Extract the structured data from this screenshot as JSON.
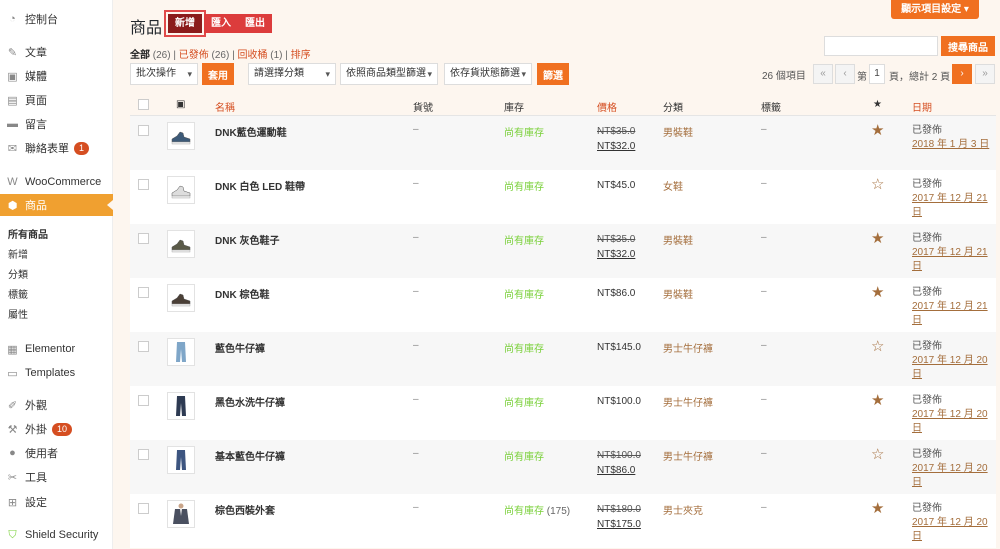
{
  "sidebar": {
    "items": [
      {
        "label": "控制台",
        "icon": "dashboard-icon",
        "glyph": "◔"
      },
      {
        "label": "文章",
        "icon": "pushpin-icon",
        "glyph": "✎"
      },
      {
        "label": "媒體",
        "icon": "media-icon",
        "glyph": "▣"
      },
      {
        "label": "頁面",
        "icon": "page-icon",
        "glyph": "▤"
      },
      {
        "label": "留言",
        "icon": "comment-icon",
        "glyph": "▬"
      },
      {
        "label": "聯絡表單",
        "icon": "mail-icon",
        "glyph": "✉",
        "badge": "1"
      },
      {
        "label": "WooCommerce",
        "icon": "woocommerce-icon",
        "glyph": "W"
      },
      {
        "label": "商品",
        "icon": "product-icon",
        "glyph": "⬢"
      },
      {
        "label": "Elementor",
        "icon": "elementor-icon",
        "glyph": "▦"
      },
      {
        "label": "Templates",
        "icon": "folder-icon",
        "glyph": "▭"
      },
      {
        "label": "外觀",
        "icon": "brush-icon",
        "glyph": "✐"
      },
      {
        "label": "外掛",
        "icon": "plugin-icon",
        "glyph": "⚒",
        "badge": "10"
      },
      {
        "label": "使用者",
        "icon": "user-icon",
        "glyph": "●"
      },
      {
        "label": "工具",
        "icon": "wrench-icon",
        "glyph": "✂"
      },
      {
        "label": "設定",
        "icon": "settings-icon",
        "glyph": "⊞"
      },
      {
        "label": "Shield Security",
        "icon": "shield-icon",
        "glyph": "⛉"
      }
    ],
    "subitems": [
      {
        "label": "所有商品"
      },
      {
        "label": "新增"
      },
      {
        "label": "分類"
      },
      {
        "label": "標籤"
      },
      {
        "label": "屬性"
      }
    ]
  },
  "header": {
    "title": "商品",
    "new_label": "新增",
    "import_label": "匯入",
    "export_label": "匯出",
    "screen_options": "顯示項目設定 ▾"
  },
  "views": {
    "all": "全部",
    "all_count": "(26)",
    "published": "已發佈",
    "published_count": "(26)",
    "trash": "回收桶",
    "trash_count": "(1)",
    "sort": "排序"
  },
  "search": {
    "button": "搜尋商品",
    "value": ""
  },
  "filters": {
    "bulk": "批次操作",
    "apply": "套用",
    "category": "請選擇分類",
    "type": "依照商品類型篩選",
    "stock": "依存貨狀態篩選",
    "filter": "篩選"
  },
  "pagination": {
    "count": "26 個項目",
    "first": "«",
    "prev": "‹",
    "page_label": "第",
    "page": "1",
    "total": "頁，總計 2 頁",
    "next": "›",
    "last": "»"
  },
  "table": {
    "headers": {
      "image": "▣",
      "name": "名稱",
      "sku": "貨號",
      "stock": "庫存",
      "price": "價格",
      "category": "分類",
      "tags": "標籤",
      "featured": "★",
      "date": "日期"
    },
    "rows": [
      {
        "name": "DNK藍色運動鞋",
        "sku": "–",
        "stock": "尚有庫存",
        "qty": "",
        "price_old": "NT$35.0",
        "price_new": "NT$32.0",
        "price": "",
        "category": "男裝鞋",
        "tags": "–",
        "featured": "★",
        "status": "已發佈",
        "date": "2018 年 1 月 3 日",
        "thumb": "shoe",
        "thumb_color": "#3d5a78"
      },
      {
        "name": "DNK 白色 LED 鞋帶",
        "sku": "–",
        "stock": "尚有庫存",
        "qty": "",
        "price_old": "",
        "price_new": "",
        "price": "NT$45.0",
        "category": "女鞋",
        "tags": "–",
        "featured": "☆",
        "status": "已發佈",
        "date": "2017 年 12 月 21 日",
        "thumb": "shoe",
        "thumb_color": "#dddddd"
      },
      {
        "name": "DNK 灰色鞋子",
        "sku": "–",
        "stock": "尚有庫存",
        "qty": "",
        "price_old": "NT$35.0",
        "price_new": "NT$32.0",
        "price": "",
        "category": "男裝鞋",
        "tags": "–",
        "featured": "★",
        "status": "已發佈",
        "date": "2017 年 12 月 21 日",
        "thumb": "shoe",
        "thumb_color": "#5a5a48"
      },
      {
        "name": "DNK 棕色鞋",
        "sku": "–",
        "stock": "尚有庫存",
        "qty": "",
        "price_old": "",
        "price_new": "",
        "price": "NT$86.0",
        "category": "男裝鞋",
        "tags": "–",
        "featured": "★",
        "status": "已發佈",
        "date": "2017 年 12 月 21 日",
        "thumb": "shoe",
        "thumb_color": "#4a3f36"
      },
      {
        "name": "藍色牛仔褲",
        "sku": "–",
        "stock": "尚有庫存",
        "qty": "",
        "price_old": "",
        "price_new": "",
        "price": "NT$145.0",
        "category": "男士牛仔褲",
        "tags": "–",
        "featured": "☆",
        "status": "已發佈",
        "date": "2017 年 12 月 20 日",
        "thumb": "pants",
        "thumb_color": "#7fa6c8"
      },
      {
        "name": "黑色水洗牛仔褲",
        "sku": "–",
        "stock": "尚有庫存",
        "qty": "",
        "price_old": "",
        "price_new": "",
        "price": "NT$100.0",
        "category": "男士牛仔褲",
        "tags": "–",
        "featured": "★",
        "status": "已發佈",
        "date": "2017 年 12 月 20 日",
        "thumb": "pants",
        "thumb_color": "#2d3a52"
      },
      {
        "name": "基本藍色牛仔褲",
        "sku": "–",
        "stock": "尚有庫存",
        "qty": "",
        "price_old": "NT$100.0",
        "price_new": "NT$86.0",
        "price": "",
        "category": "男士牛仔褲",
        "tags": "–",
        "featured": "☆",
        "status": "已發佈",
        "date": "2017 年 12 月 20 日",
        "thumb": "pants",
        "thumb_color": "#3d5580"
      },
      {
        "name": "棕色西裝外套",
        "sku": "–",
        "stock": "尚有庫存",
        "qty": "(175)",
        "price_old": "NT$180.0",
        "price_new": "NT$175.0",
        "price": "",
        "category": "男士夾克",
        "tags": "–",
        "featured": "★",
        "status": "已發佈",
        "date": "2017 年 12 月 20 日",
        "thumb": "jacket",
        "thumb_color": "#4a5060"
      }
    ]
  },
  "colors": {
    "accent": "#f07020",
    "active_menu": "#f0a030",
    "danger": "#dc3c3c",
    "link": "#a46e3c",
    "in_stock": "#7ad03a"
  }
}
